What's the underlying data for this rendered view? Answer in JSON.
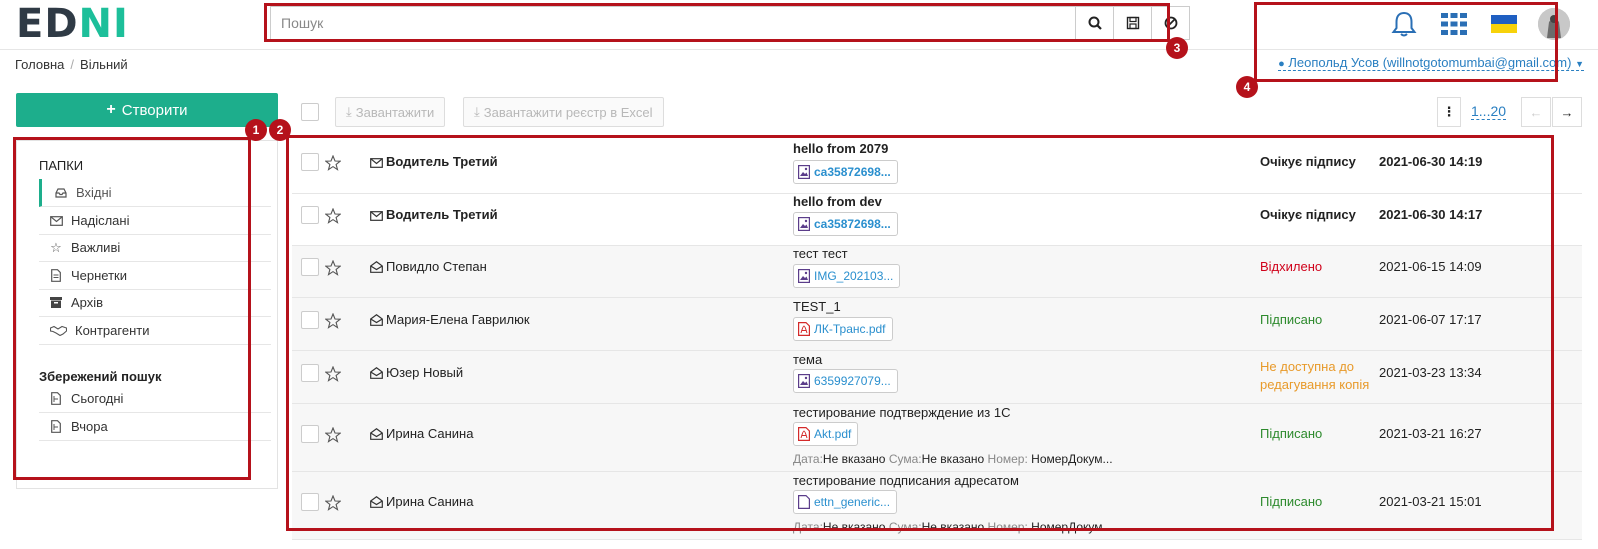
{
  "logo": {
    "part1": "ED",
    "part2": "N",
    "part3": "I"
  },
  "search": {
    "placeholder": "Пошук"
  },
  "user": {
    "label": "Леопольд Усов (willnotgotomumbai@gmail.com)"
  },
  "breadcrumb": {
    "home": "Головна",
    "current": "Вільний"
  },
  "sidebar": {
    "create_label": "Створити",
    "folders_title": "ПАПКИ",
    "folders": [
      {
        "label": "Вхідні",
        "icon": "inbox-icon"
      },
      {
        "label": "Надіслані",
        "icon": "envelope-icon"
      },
      {
        "label": "Важливі",
        "icon": "star-icon"
      },
      {
        "label": "Чернетки",
        "icon": "file-icon"
      },
      {
        "label": "Архів",
        "icon": "archive-icon"
      },
      {
        "label": "Контрагенти",
        "icon": "handshake-icon"
      }
    ],
    "saved_title": "Збережений пошук",
    "saved": [
      {
        "label": "Сьогодні"
      },
      {
        "label": "Вчора"
      }
    ]
  },
  "toolbar": {
    "download_label": "Завантажити",
    "download_excel_label": "Завантажити реєстр в Excel",
    "pager_range": "1...20"
  },
  "documents": [
    {
      "sender": "Водитель Третий",
      "subject": "hello from 2079",
      "file": "ca35872698...",
      "file_type": "image",
      "status": "Очікує підпису",
      "date": "2021-06-30 14:19",
      "unread": true
    },
    {
      "sender": "Водитель Третий",
      "subject": "hello from dev",
      "file": "ca35872698...",
      "file_type": "image",
      "status": "Очікує підпису",
      "date": "2021-06-30 14:17",
      "unread": true
    },
    {
      "sender": "Повидло Степан",
      "subject": "тест тест",
      "file": "IMG_202103...",
      "file_type": "image",
      "status": "Відхилено",
      "date": "2021-06-15 14:09",
      "unread": false
    },
    {
      "sender": "Мария-Елена Гаврилюк",
      "subject": "TEST_1",
      "file": "ЛК-Транс.pdf",
      "file_type": "pdf",
      "status": "Підписано",
      "date": "2021-06-07 17:17",
      "unread": false
    },
    {
      "sender": "Юзер Новый",
      "subject": "тема",
      "file": "6359927079...",
      "file_type": "image",
      "status_line1": "Не доступна до",
      "status_line2": "редагування копія",
      "date": "2021-03-23 13:34",
      "unread": false
    },
    {
      "sender": "Ирина Санина",
      "subject": "тестирование подтверждение из 1С",
      "file": "Akt.pdf",
      "file_type": "pdf",
      "status": "Підписано",
      "date": "2021-03-21 16:27",
      "unread": false,
      "meta": {
        "date_label": "Дата:",
        "date_value": "Не вказано",
        "sum_label": "Сума:",
        "sum_value": "Не вказано",
        "num_label": "Номер:",
        "num_value": "НомерДокум..."
      }
    },
    {
      "sender": "Ирина Санина",
      "subject": "тестирование подписания адресатом",
      "file": "ettn_generic...",
      "file_type": "file",
      "status": "Підписано",
      "date": "2021-03-21 15:01",
      "unread": false,
      "meta": {
        "date_label": "Дата:",
        "date_value": "Не вказано",
        "sum_label": "Сума:",
        "sum_value": "Не вказано",
        "num_label": "Номер:",
        "num_value": "НомерДокум..."
      }
    }
  ],
  "annotations": [
    "1",
    "2",
    "3",
    "4"
  ],
  "colors": {
    "accent": "#1dae8c",
    "annotation": "#b5121b",
    "link": "#2a7fc1",
    "rejected": "#d0021b",
    "signed": "#2d8a2d",
    "warning": "#e89a2a"
  }
}
